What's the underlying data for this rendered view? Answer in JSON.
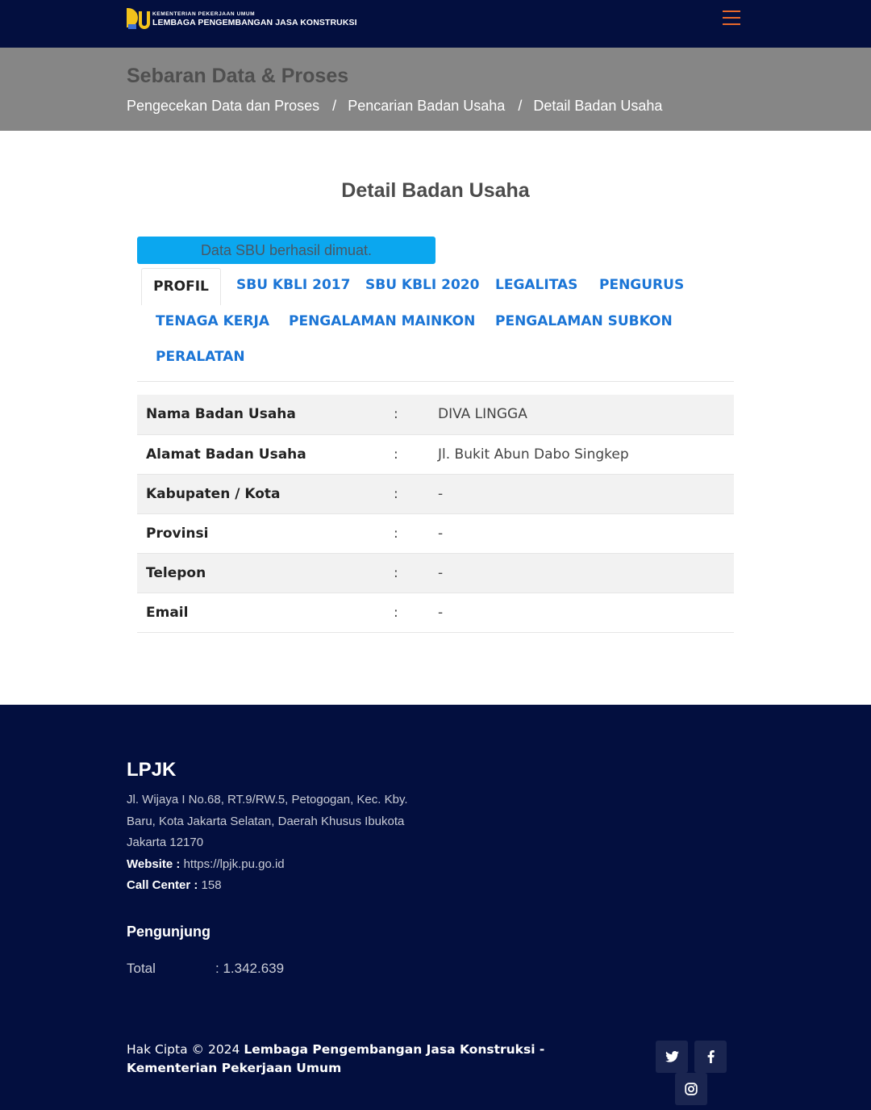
{
  "navbar": {
    "logo_small": "KEMENTERIAN PEKERJAAN UMUM",
    "logo_big": "LEMBAGA PENGEMBANGAN JASA KONSTRUKSI"
  },
  "header": {
    "title": "Sebaran Data & Proses",
    "breadcrumb": [
      "Pengecekan Data dan Proses",
      "Pencarian Badan Usaha",
      "Detail Badan Usaha"
    ],
    "separator": "/"
  },
  "main": {
    "title": "Detail Badan Usaha",
    "alert": "Data SBU berhasil dimuat.",
    "tabs": [
      "PROFIL",
      "SBU KBLI 2017",
      "SBU KBLI 2020",
      "LEGALITAS",
      "PENGURUS",
      "TENAGA KERJA",
      "PENGALAMAN MAINKON",
      "PENGALAMAN SUBKON",
      "PERALATAN"
    ],
    "active_tab": "PROFIL",
    "profile": [
      {
        "label": "Nama Badan Usaha",
        "colon": ":",
        "value": "DIVA LINGGA"
      },
      {
        "label": "Alamat Badan Usaha",
        "colon": ":",
        "value": "Jl. Bukit Abun Dabo Singkep"
      },
      {
        "label": "Kabupaten / Kota",
        "colon": ":",
        "value": "-"
      },
      {
        "label": "Provinsi",
        "colon": ":",
        "value": "-"
      },
      {
        "label": "Telepon",
        "colon": ":",
        "value": "-"
      },
      {
        "label": "Email",
        "colon": ":",
        "value": "-"
      }
    ]
  },
  "footer": {
    "brand": "LPJK",
    "address": "Jl. Wijaya I No.68, RT.9/RW.5, Petogogan, Kec. Kby. Baru, Kota Jakarta Selatan, Daerah Khusus Ibukota Jakarta 12170",
    "website_label": "Website :",
    "website": "https://lpjk.pu.go.id",
    "callcenter_label": "Call Center :",
    "callcenter": "158",
    "visitors_title": "Pengunjung",
    "total_label": "Total",
    "total_value": ": 1.342.639",
    "copyright_prefix": "Hak Cipta © 2024",
    "copyright_owner": "Lembaga Pengembangan Jasa Konstruksi - Kementerian Pekerjaan Umum",
    "social_icons": [
      "twitter-icon",
      "facebook-icon",
      "instagram-icon"
    ]
  },
  "colors": {
    "navy": "#030f3f",
    "accent_orange": "#e8682a",
    "link_blue": "#1b75d6",
    "alert_blue": "#0ba7ef",
    "header_gray": "#868686"
  }
}
